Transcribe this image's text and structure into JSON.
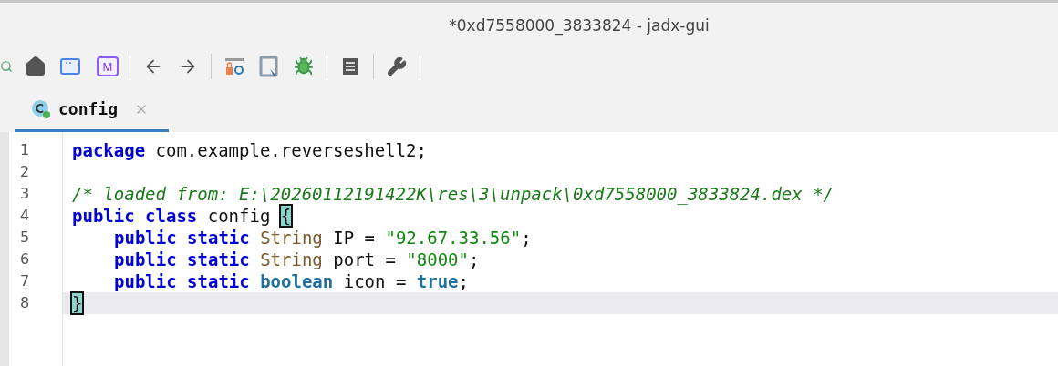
{
  "window": {
    "title": "*0xd7558000_3833824 - jadx-gui"
  },
  "toolbar": {
    "m_icon_letter": "M"
  },
  "tabs": [
    {
      "label": "config",
      "selected": true
    }
  ],
  "editor": {
    "lines": [
      {
        "number": "1",
        "current": false,
        "tokens": [
          {
            "kind": "keyword",
            "text": "package"
          },
          {
            "kind": "plain",
            "text": "com.example.reverseshell2;"
          }
        ]
      },
      {
        "number": "2"
      },
      {
        "number": "3",
        "current": false,
        "tokens": [
          {
            "kind": "comment",
            "text": "/* loaded from: E:\\20260112191422K\\res\\3\\unpack\\0xd7558000_3833824.dex */"
          }
        ]
      },
      {
        "number": "4",
        "current": false,
        "tokens": [
          {
            "kind": "keyword",
            "text": "public class"
          },
          {
            "kind": "plain",
            "text": "config"
          },
          {
            "kind": "brace",
            "text": "{"
          }
        ]
      },
      {
        "number": "5",
        "current": false,
        "indented": true,
        "tokens": [
          {
            "kind": "keyword",
            "text": "public static"
          },
          {
            "kind": "type",
            "text": "String"
          },
          {
            "kind": "plain",
            "text": "IP ="
          },
          {
            "kind": "string",
            "text": "\"92.67.33.56\""
          },
          {
            "kind": "punct",
            "text": ";"
          }
        ]
      },
      {
        "number": "6",
        "current": false,
        "indented": true,
        "tokens": [
          {
            "kind": "keyword",
            "text": "public static"
          },
          {
            "kind": "type",
            "text": "String"
          },
          {
            "kind": "plain",
            "text": "port ="
          },
          {
            "kind": "string",
            "text": "\"8000\""
          },
          {
            "kind": "punct",
            "text": ";"
          }
        ]
      },
      {
        "number": "7",
        "current": false,
        "indented": true,
        "tokens": [
          {
            "kind": "keyword",
            "text": "public static"
          },
          {
            "kind": "primitive",
            "text": "boolean"
          },
          {
            "kind": "plain",
            "text": "icon ="
          },
          {
            "kind": "primitive",
            "text": "true"
          },
          {
            "kind": "punct",
            "text": ";"
          }
        ]
      },
      {
        "number": "8",
        "current": true,
        "tokens": [
          {
            "kind": "brace",
            "text": "}"
          }
        ]
      }
    ]
  }
}
